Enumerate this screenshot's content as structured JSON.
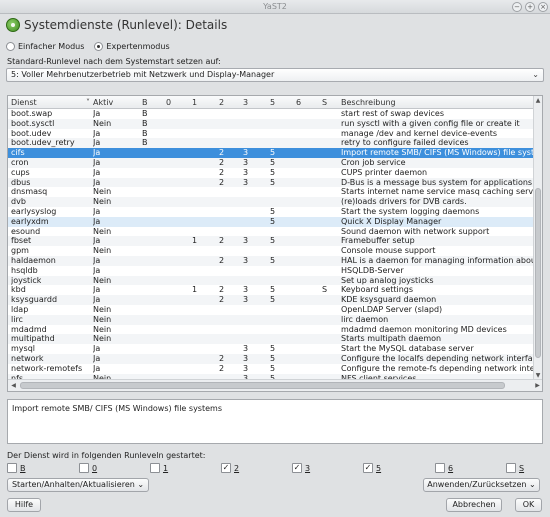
{
  "window": {
    "title": "YaST2"
  },
  "header": {
    "title": "Systemdienste (Runlevel): Details"
  },
  "modes": {
    "simple": "Einfacher Modus",
    "expert": "Expertenmodus"
  },
  "runlevel": {
    "label": "Standard-Runlevel nach dem Systemstart setzen auf:",
    "value": "5: Voller Mehrbenutzerbetrieb mit Netzwerk und Display-Manager"
  },
  "table": {
    "columns": [
      "Dienst",
      "Aktiv",
      "B",
      "0",
      "1",
      "2",
      "3",
      "5",
      "6",
      "S",
      "Beschreibung"
    ],
    "rows": [
      [
        "boot.swap",
        "Ja",
        "B",
        "",
        "",
        "",
        "",
        "",
        "",
        "",
        "start rest of swap devices"
      ],
      [
        "boot.sysctl",
        "Nein",
        "B",
        "",
        "",
        "",
        "",
        "",
        "",
        "",
        "run sysctl with a given config file or create it"
      ],
      [
        "boot.udev",
        "Ja",
        "B",
        "",
        "",
        "",
        "",
        "",
        "",
        "",
        "manage /dev and kernel device-events"
      ],
      [
        "boot.udev_retry",
        "Ja",
        "B",
        "",
        "",
        "",
        "",
        "",
        "",
        "",
        "retry to configure failed devices"
      ],
      [
        "cifs",
        "Ja",
        "",
        "",
        "",
        "2",
        "3",
        "5",
        "",
        "",
        "Import remote SMB/ CIFS (MS Windows) file syste"
      ],
      [
        "cron",
        "Ja",
        "",
        "",
        "",
        "2",
        "3",
        "5",
        "",
        "",
        "Cron job service"
      ],
      [
        "cups",
        "Ja",
        "",
        "",
        "",
        "2",
        "3",
        "5",
        "",
        "",
        "CUPS printer daemon"
      ],
      [
        "dbus",
        "Ja",
        "",
        "",
        "",
        "2",
        "3",
        "5",
        "",
        "",
        "D-Bus is a message bus system for applications to"
      ],
      [
        "dnsmasq",
        "Nein",
        "",
        "",
        "",
        "",
        "",
        "",
        "",
        "",
        "Starts internet name service masq caching server"
      ],
      [
        "dvb",
        "Nein",
        "",
        "",
        "",
        "",
        "",
        "",
        "",
        "",
        "(re)loads drivers for DVB cards."
      ],
      [
        "earlysyslog",
        "Ja",
        "",
        "",
        "",
        "",
        "",
        "5",
        "",
        "",
        "Start the system logging daemons"
      ],
      [
        "earlyxdm",
        "Ja",
        "",
        "",
        "",
        "",
        "",
        "5",
        "",
        "",
        "Quick X Display Manager"
      ],
      [
        "esound",
        "Nein",
        "",
        "",
        "",
        "",
        "",
        "",
        "",
        "",
        "Sound daemon with network support"
      ],
      [
        "fbset",
        "Ja",
        "",
        "",
        "1",
        "2",
        "3",
        "5",
        "",
        "",
        "Framebuffer setup"
      ],
      [
        "gpm",
        "Nein",
        "",
        "",
        "",
        "",
        "",
        "",
        "",
        "",
        "Console mouse support"
      ],
      [
        "haldaemon",
        "Ja",
        "",
        "",
        "",
        "2",
        "3",
        "5",
        "",
        "",
        "HAL is a daemon for managing information about"
      ],
      [
        "hsqldb",
        "Ja",
        "",
        "",
        "",
        "",
        "",
        "",
        "",
        "",
        "HSQLDB-Server"
      ],
      [
        "joystick",
        "Nein",
        "",
        "",
        "",
        "",
        "",
        "",
        "",
        "",
        "Set up analog joysticks"
      ],
      [
        "kbd",
        "Ja",
        "",
        "",
        "1",
        "2",
        "3",
        "5",
        "",
        "S",
        "Keyboard settings"
      ],
      [
        "ksysguardd",
        "Ja",
        "",
        "",
        "",
        "2",
        "3",
        "5",
        "",
        "",
        "KDE ksysguard daemon"
      ],
      [
        "ldap",
        "Nein",
        "",
        "",
        "",
        "",
        "",
        "",
        "",
        "",
        "OpenLDAP Server (slapd)"
      ],
      [
        "lirc",
        "Nein",
        "",
        "",
        "",
        "",
        "",
        "",
        "",
        "",
        "lirc daemon"
      ],
      [
        "mdadmd",
        "Nein",
        "",
        "",
        "",
        "",
        "",
        "",
        "",
        "",
        "mdadmd daemon monitoring MD devices"
      ],
      [
        "multipathd",
        "Nein",
        "",
        "",
        "",
        "",
        "",
        "",
        "",
        "",
        "Starts multipath daemon"
      ],
      [
        "mysql",
        "Ja",
        "",
        "",
        "",
        "",
        "3",
        "5",
        "",
        "",
        "Start the MySQL database server"
      ],
      [
        "network",
        "Ja",
        "",
        "",
        "",
        "2",
        "3",
        "5",
        "",
        "",
        "Configure the localfs depending network interface"
      ],
      [
        "network-remotefs",
        "Ja",
        "",
        "",
        "",
        "2",
        "3",
        "5",
        "",
        "",
        "Configure the remote-fs depending network interf"
      ],
      [
        "nfs",
        "Nein",
        "",
        "",
        "",
        "",
        "3",
        "5",
        "",
        "",
        "NFS client services"
      ]
    ]
  },
  "description": "Import remote SMB/ CIFS (MS Windows) file systems",
  "levels": {
    "label": "Der Dienst wird in folgenden Runleveln gestartet:",
    "items": [
      {
        "label": "B",
        "checked": false
      },
      {
        "label": "0",
        "checked": false
      },
      {
        "label": "1",
        "checked": false
      },
      {
        "label": "2",
        "checked": true
      },
      {
        "label": "3",
        "checked": true
      },
      {
        "label": "5",
        "checked": true
      },
      {
        "label": "6",
        "checked": false
      },
      {
        "label": "S",
        "checked": false
      }
    ]
  },
  "buttons": {
    "start_stop": "Starten/Anhalten/Aktualisieren",
    "apply_reset": "Anwenden/Zurücksetzen",
    "help": "Hilfe",
    "cancel": "Abbrechen",
    "ok": "OK"
  },
  "icons": {
    "window": "yast-icon",
    "dropdown": "chevron-down-icon",
    "check": "check-icon"
  }
}
